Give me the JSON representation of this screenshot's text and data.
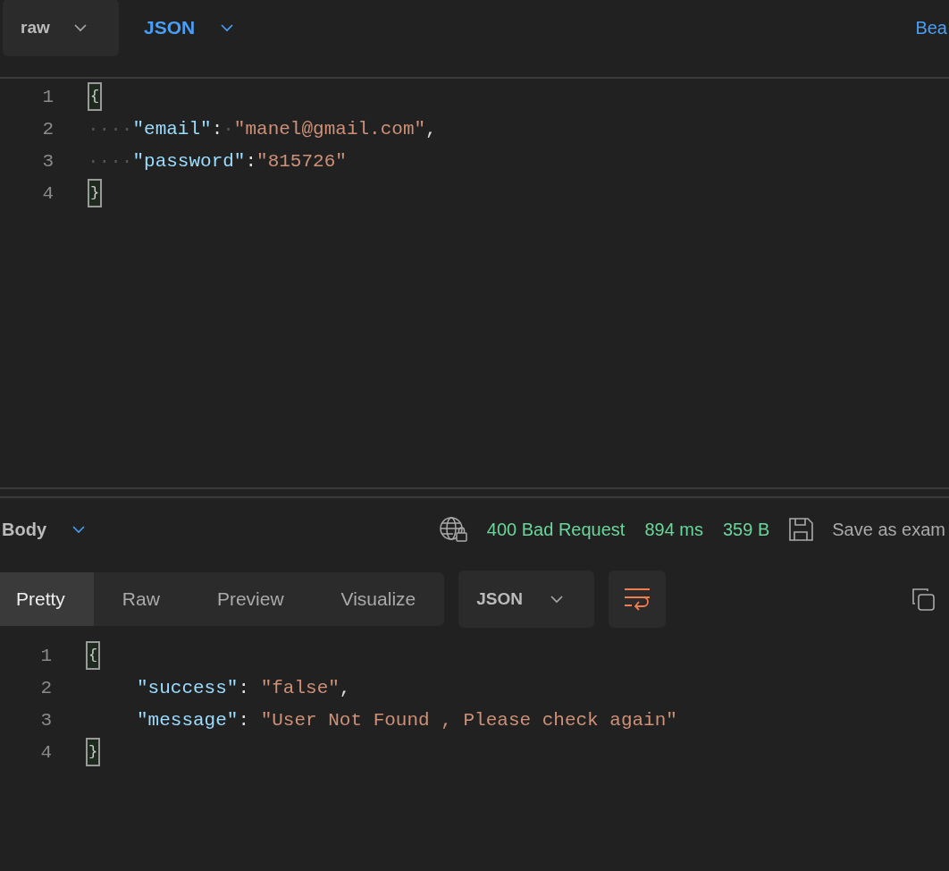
{
  "request_toolbar": {
    "body_type": "raw",
    "language": "JSON",
    "beautify_link": "Bea"
  },
  "request_editor": {
    "lines": [
      {
        "number": "1",
        "tokens": [
          {
            "kind": "brace",
            "text": "{",
            "matched": true
          }
        ]
      },
      {
        "number": "2",
        "tokens": [
          {
            "kind": "whitespace",
            "text": "····"
          },
          {
            "kind": "key",
            "text": "\"email\""
          },
          {
            "kind": "punct",
            "text": ":"
          },
          {
            "kind": "whitespace",
            "text": "·"
          },
          {
            "kind": "string",
            "text": "\"manel@gmail.com\""
          },
          {
            "kind": "punct",
            "text": ","
          }
        ]
      },
      {
        "number": "3",
        "tokens": [
          {
            "kind": "whitespace",
            "text": "····"
          },
          {
            "kind": "key",
            "text": "\"password\""
          },
          {
            "kind": "punct",
            "text": ":"
          },
          {
            "kind": "string",
            "text": "\"815726\""
          }
        ]
      },
      {
        "number": "4",
        "tokens": [
          {
            "kind": "brace",
            "text": "}",
            "matched": true
          }
        ]
      }
    ]
  },
  "response_header": {
    "section": "Body",
    "status": "400 Bad Request",
    "time": "894 ms",
    "size": "359 B",
    "save_button": "Save as exam"
  },
  "response_tabs": [
    {
      "label": "Pretty",
      "selected": true
    },
    {
      "label": "Raw",
      "selected": false
    },
    {
      "label": "Preview",
      "selected": false
    },
    {
      "label": "Visualize",
      "selected": false
    }
  ],
  "response_format": "JSON",
  "response_editor": {
    "lines": [
      {
        "number": "1",
        "tokens": [
          {
            "kind": "brace",
            "text": "{",
            "matched": true
          }
        ]
      },
      {
        "number": "2",
        "tokens": [
          {
            "kind": "key",
            "text": "\"success\""
          },
          {
            "kind": "punct",
            "text": ": "
          },
          {
            "kind": "string",
            "text": "\"false\""
          },
          {
            "kind": "punct",
            "text": ","
          }
        ]
      },
      {
        "number": "3",
        "tokens": [
          {
            "kind": "key",
            "text": "\"message\""
          },
          {
            "kind": "punct",
            "text": ": "
          },
          {
            "kind": "string",
            "text": "\"User Not Found , Please check again\""
          }
        ]
      },
      {
        "number": "4",
        "tokens": [
          {
            "kind": "brace",
            "text": "}",
            "matched": true
          }
        ]
      }
    ]
  }
}
